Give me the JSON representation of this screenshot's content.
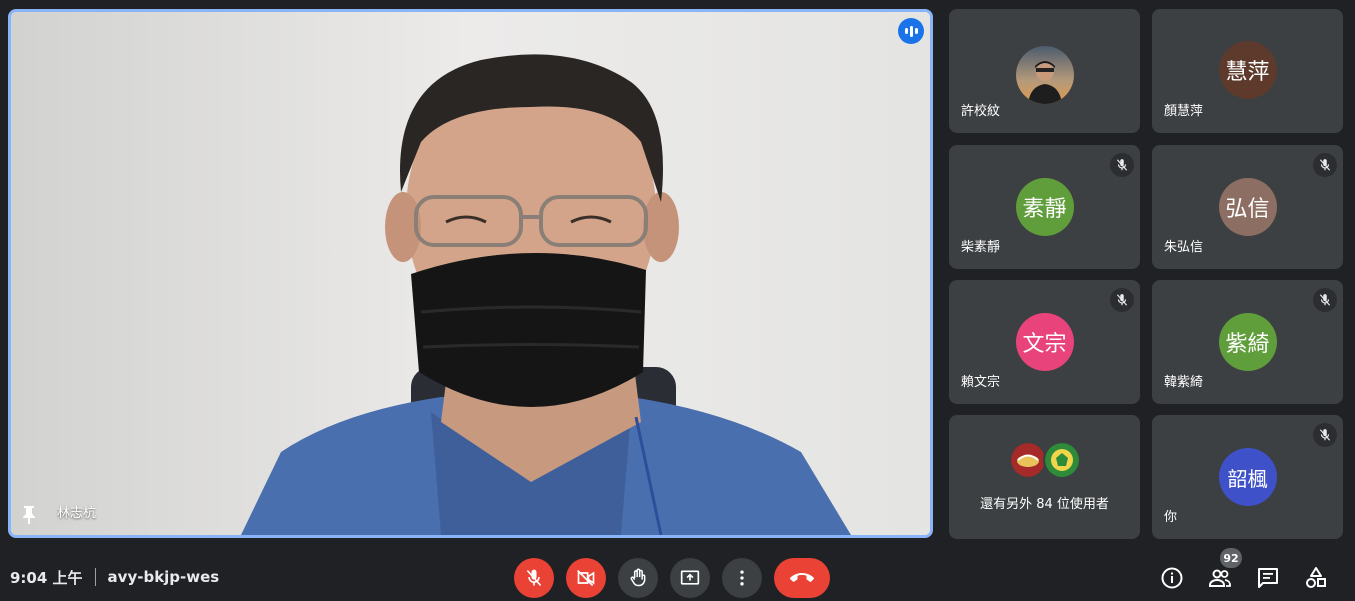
{
  "main": {
    "speaker_name": "林志杭",
    "speaking_indicator_color": "#1a73e8",
    "border_color": "#8ab4f8"
  },
  "tiles": [
    {
      "name": "許校紋",
      "avatar_text": "",
      "avatar_type": "photo",
      "muted": false
    },
    {
      "name": "顏慧萍",
      "avatar_text": "慧萍",
      "avatar_color": "#5d3a2c",
      "muted": false
    },
    {
      "name": "柴素靜",
      "avatar_text": "素靜",
      "avatar_color": "#5f9e3a",
      "muted": true
    },
    {
      "name": "朱弘信",
      "avatar_text": "弘信",
      "avatar_color": "#8d6e63",
      "muted": true
    },
    {
      "name": "賴文宗",
      "avatar_text": "文宗",
      "avatar_color": "#e8437a",
      "muted": true
    },
    {
      "name": "韓紫綺",
      "avatar_text": "紫綺",
      "avatar_color": "#5f9e3a",
      "muted": true
    },
    {
      "name": "你",
      "avatar_text": "韶楓",
      "avatar_color": "#3f51c9",
      "muted": true
    }
  ],
  "others": {
    "label": "還有另外 84 位使用者"
  },
  "bottom": {
    "time": "9:04 上午",
    "meeting_code": "avy-bkjp-wes",
    "participant_count": "92"
  },
  "icons": {
    "mic": "mic-off-icon",
    "camera": "videocam-off-icon",
    "hand": "raise-hand-icon",
    "present": "present-screen-icon",
    "more": "more-vert-icon",
    "hangup": "call-end-icon",
    "info": "info-icon",
    "people": "people-icon",
    "chat": "chat-icon",
    "activities": "activities-icon"
  }
}
